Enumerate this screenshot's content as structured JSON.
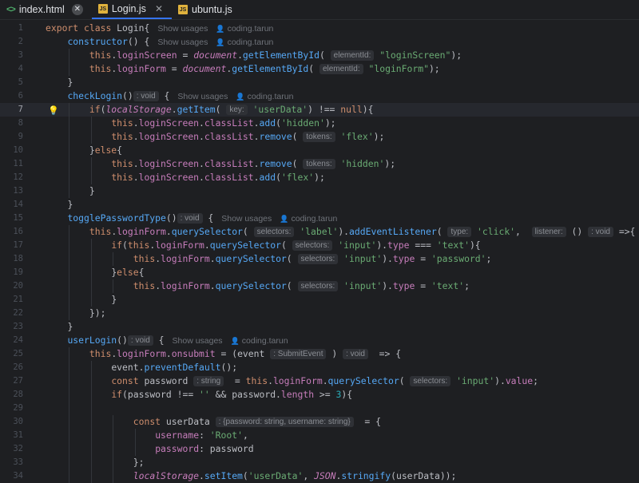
{
  "tabs": [
    {
      "label": "index.html",
      "icon": "html-file-icon",
      "active": false,
      "close": "✕"
    },
    {
      "label": "Login.js",
      "icon": "js-file-icon",
      "active": true,
      "close": "✕"
    },
    {
      "label": "ubuntu.js",
      "icon": "js-file-icon",
      "active": false
    }
  ],
  "editor": {
    "current_line": 7,
    "theme_colors": {
      "keyword": "#cf8e6d",
      "function": "#56a8f5",
      "string": "#6aab73",
      "number": "#2aacb8",
      "global": "#c77dbb"
    },
    "lines": [
      {
        "n": "1",
        "indent": 0,
        "tokens": [
          [
            "kw",
            "export "
          ],
          [
            "kw",
            "class "
          ],
          [
            "pl",
            "Login{"
          ],
          [
            "meta",
            "Show usages"
          ],
          [
            "author",
            "coding.tarun"
          ]
        ]
      },
      {
        "n": "2",
        "indent": 1,
        "tokens": [
          [
            "fn",
            "constructor"
          ],
          [
            "pl",
            "() {"
          ],
          [
            "meta",
            "Show usages"
          ],
          [
            "author",
            "coding.tarun"
          ]
        ]
      },
      {
        "n": "3",
        "indent": 2,
        "tokens": [
          [
            "kw",
            "this"
          ],
          [
            "pl",
            "."
          ],
          [
            "prop",
            "loginScreen"
          ],
          [
            "pl",
            " = "
          ],
          [
            "gv",
            "document"
          ],
          [
            "pl",
            "."
          ],
          [
            "fn",
            "getElementById"
          ],
          [
            "pl",
            "( "
          ],
          [
            "hint",
            "elementId:"
          ],
          [
            "str",
            " \"loginScreen\""
          ],
          [
            "pl",
            ");"
          ]
        ]
      },
      {
        "n": "4",
        "indent": 2,
        "tokens": [
          [
            "kw",
            "this"
          ],
          [
            "pl",
            "."
          ],
          [
            "prop",
            "loginForm"
          ],
          [
            "pl",
            " = "
          ],
          [
            "gv",
            "document"
          ],
          [
            "pl",
            "."
          ],
          [
            "fn",
            "getElementById"
          ],
          [
            "pl",
            "( "
          ],
          [
            "hint",
            "elementId:"
          ],
          [
            "str",
            " \"loginForm\""
          ],
          [
            "pl",
            ");"
          ]
        ]
      },
      {
        "n": "5",
        "indent": 1,
        "tokens": [
          [
            "pl",
            "}"
          ]
        ]
      },
      {
        "n": "6",
        "indent": 1,
        "tokens": [
          [
            "fn",
            "checkLogin"
          ],
          [
            "pl",
            "()"
          ],
          [
            "hint",
            ": void"
          ],
          [
            "pl",
            " {"
          ],
          [
            "meta",
            "Show usages"
          ],
          [
            "author",
            "coding.tarun"
          ]
        ]
      },
      {
        "n": "7",
        "indent": 2,
        "tokens": [
          [
            "kw",
            "if"
          ],
          [
            "pl",
            "("
          ],
          [
            "gv",
            "localStorage"
          ],
          [
            "pl",
            "."
          ],
          [
            "fn",
            "getItem"
          ],
          [
            "pl",
            "( "
          ],
          [
            "hint",
            "key:"
          ],
          [
            "str",
            " 'userData'"
          ],
          [
            "pl",
            ") !== "
          ],
          [
            "kw",
            "null"
          ],
          [
            "pl",
            "){"
          ]
        ]
      },
      {
        "n": "8",
        "indent": 3,
        "tokens": [
          [
            "kw",
            "this"
          ],
          [
            "pl",
            "."
          ],
          [
            "prop",
            "loginScreen"
          ],
          [
            "pl",
            "."
          ],
          [
            "prop",
            "classList"
          ],
          [
            "pl",
            "."
          ],
          [
            "fn",
            "add"
          ],
          [
            "pl",
            "("
          ],
          [
            "str",
            "'hidden'"
          ],
          [
            "pl",
            ");"
          ]
        ]
      },
      {
        "n": "9",
        "indent": 3,
        "tokens": [
          [
            "kw",
            "this"
          ],
          [
            "pl",
            "."
          ],
          [
            "prop",
            "loginScreen"
          ],
          [
            "pl",
            "."
          ],
          [
            "prop",
            "classList"
          ],
          [
            "pl",
            "."
          ],
          [
            "fn",
            "remove"
          ],
          [
            "pl",
            "( "
          ],
          [
            "hint",
            "tokens:"
          ],
          [
            "str",
            " 'flex'"
          ],
          [
            "pl",
            ");"
          ]
        ]
      },
      {
        "n": "10",
        "indent": 2,
        "tokens": [
          [
            "pl",
            "}"
          ],
          [
            "kw",
            "else"
          ],
          [
            "pl",
            "{"
          ]
        ]
      },
      {
        "n": "11",
        "indent": 3,
        "tokens": [
          [
            "kw",
            "this"
          ],
          [
            "pl",
            "."
          ],
          [
            "prop",
            "loginScreen"
          ],
          [
            "pl",
            "."
          ],
          [
            "prop",
            "classList"
          ],
          [
            "pl",
            "."
          ],
          [
            "fn",
            "remove"
          ],
          [
            "pl",
            "( "
          ],
          [
            "hint",
            "tokens:"
          ],
          [
            "str",
            " 'hidden'"
          ],
          [
            "pl",
            ");"
          ]
        ]
      },
      {
        "n": "12",
        "indent": 3,
        "tokens": [
          [
            "kw",
            "this"
          ],
          [
            "pl",
            "."
          ],
          [
            "prop",
            "loginScreen"
          ],
          [
            "pl",
            "."
          ],
          [
            "prop",
            "classList"
          ],
          [
            "pl",
            "."
          ],
          [
            "fn",
            "add"
          ],
          [
            "pl",
            "("
          ],
          [
            "str",
            "'flex'"
          ],
          [
            "pl",
            ");"
          ]
        ]
      },
      {
        "n": "13",
        "indent": 2,
        "tokens": [
          [
            "pl",
            "}"
          ]
        ]
      },
      {
        "n": "14",
        "indent": 1,
        "tokens": [
          [
            "pl",
            "}"
          ]
        ]
      },
      {
        "n": "15",
        "indent": 1,
        "tokens": [
          [
            "fn",
            "togglePasswordType"
          ],
          [
            "pl",
            "()"
          ],
          [
            "hint",
            ": void"
          ],
          [
            "pl",
            " {"
          ],
          [
            "meta",
            "Show usages"
          ],
          [
            "author",
            "coding.tarun"
          ]
        ]
      },
      {
        "n": "16",
        "indent": 2,
        "tokens": [
          [
            "kw",
            "this"
          ],
          [
            "pl",
            "."
          ],
          [
            "prop",
            "loginForm"
          ],
          [
            "pl",
            "."
          ],
          [
            "fn",
            "querySelector"
          ],
          [
            "pl",
            "( "
          ],
          [
            "hint",
            "selectors:"
          ],
          [
            "str",
            " 'label'"
          ],
          [
            "pl",
            ")."
          ],
          [
            "fn",
            "addEventListener"
          ],
          [
            "pl",
            "( "
          ],
          [
            "hint",
            "type:"
          ],
          [
            "str",
            " 'click'"
          ],
          [
            "pl",
            ",  "
          ],
          [
            "hint",
            "listener:"
          ],
          [
            "pl",
            " () "
          ],
          [
            "hint",
            ": void"
          ],
          [
            "pl",
            " =>{"
          ]
        ]
      },
      {
        "n": "17",
        "indent": 3,
        "tokens": [
          [
            "kw",
            "if"
          ],
          [
            "pl",
            "("
          ],
          [
            "kw",
            "this"
          ],
          [
            "pl",
            "."
          ],
          [
            "prop",
            "loginForm"
          ],
          [
            "pl",
            "."
          ],
          [
            "fn",
            "querySelector"
          ],
          [
            "pl",
            "( "
          ],
          [
            "hint",
            "selectors:"
          ],
          [
            "str",
            " 'input'"
          ],
          [
            "pl",
            ")."
          ],
          [
            "prop",
            "type"
          ],
          [
            "pl",
            " === "
          ],
          [
            "str",
            "'text'"
          ],
          [
            "pl",
            "){"
          ]
        ]
      },
      {
        "n": "18",
        "indent": 4,
        "tokens": [
          [
            "kw",
            "this"
          ],
          [
            "pl",
            "."
          ],
          [
            "prop",
            "loginForm"
          ],
          [
            "pl",
            "."
          ],
          [
            "fn",
            "querySelector"
          ],
          [
            "pl",
            "( "
          ],
          [
            "hint",
            "selectors:"
          ],
          [
            "str",
            " 'input'"
          ],
          [
            "pl",
            ")."
          ],
          [
            "prop",
            "type"
          ],
          [
            "pl",
            " = "
          ],
          [
            "str",
            "'password'"
          ],
          [
            "pl",
            ";"
          ]
        ]
      },
      {
        "n": "19",
        "indent": 3,
        "tokens": [
          [
            "pl",
            "}"
          ],
          [
            "kw",
            "else"
          ],
          [
            "pl",
            "{"
          ]
        ]
      },
      {
        "n": "20",
        "indent": 4,
        "tokens": [
          [
            "kw",
            "this"
          ],
          [
            "pl",
            "."
          ],
          [
            "prop",
            "loginForm"
          ],
          [
            "pl",
            "."
          ],
          [
            "fn",
            "querySelector"
          ],
          [
            "pl",
            "( "
          ],
          [
            "hint",
            "selectors:"
          ],
          [
            "str",
            " 'input'"
          ],
          [
            "pl",
            ")."
          ],
          [
            "prop",
            "type"
          ],
          [
            "pl",
            " = "
          ],
          [
            "str",
            "'text'"
          ],
          [
            "pl",
            ";"
          ]
        ]
      },
      {
        "n": "21",
        "indent": 3,
        "tokens": [
          [
            "pl",
            "}"
          ]
        ]
      },
      {
        "n": "22",
        "indent": 2,
        "tokens": [
          [
            "pl",
            "});"
          ]
        ]
      },
      {
        "n": "23",
        "indent": 1,
        "tokens": [
          [
            "pl",
            "}"
          ]
        ]
      },
      {
        "n": "24",
        "indent": 1,
        "tokens": [
          [
            "fn",
            "userLogin"
          ],
          [
            "pl",
            "()"
          ],
          [
            "hint",
            ": void"
          ],
          [
            "pl",
            " {"
          ],
          [
            "meta",
            "Show usages"
          ],
          [
            "author",
            "coding.tarun"
          ]
        ]
      },
      {
        "n": "25",
        "indent": 2,
        "tokens": [
          [
            "kw",
            "this"
          ],
          [
            "pl",
            "."
          ],
          [
            "prop",
            "loginForm"
          ],
          [
            "pl",
            "."
          ],
          [
            "prop",
            "onsubmit"
          ],
          [
            "pl",
            " = (event "
          ],
          [
            "hint",
            ": SubmitEvent"
          ],
          [
            "pl",
            " ) "
          ],
          [
            "hint",
            ": void"
          ],
          [
            "pl",
            "  => {"
          ]
        ]
      },
      {
        "n": "26",
        "indent": 3,
        "tokens": [
          [
            "pl",
            "event."
          ],
          [
            "fn",
            "preventDefault"
          ],
          [
            "pl",
            "();"
          ]
        ]
      },
      {
        "n": "27",
        "indent": 3,
        "tokens": [
          [
            "kw",
            "const "
          ],
          [
            "pl",
            "password "
          ],
          [
            "hint",
            ": string"
          ],
          [
            "pl",
            "  = "
          ],
          [
            "kw",
            "this"
          ],
          [
            "pl",
            "."
          ],
          [
            "prop",
            "loginForm"
          ],
          [
            "pl",
            "."
          ],
          [
            "fn",
            "querySelector"
          ],
          [
            "pl",
            "( "
          ],
          [
            "hint",
            "selectors:"
          ],
          [
            "str",
            " 'input'"
          ],
          [
            "pl",
            ")."
          ],
          [
            "prop",
            "value"
          ],
          [
            "pl",
            ";"
          ]
        ]
      },
      {
        "n": "28",
        "indent": 3,
        "tokens": [
          [
            "kw",
            "if"
          ],
          [
            "pl",
            "(password !== "
          ],
          [
            "str",
            "''"
          ],
          [
            "pl",
            " && password."
          ],
          [
            "prop",
            "length"
          ],
          [
            "pl",
            " >= "
          ],
          [
            "num",
            "3"
          ],
          [
            "pl",
            "){"
          ]
        ]
      },
      {
        "n": "29",
        "indent": 3,
        "tokens": []
      },
      {
        "n": "30",
        "indent": 4,
        "tokens": [
          [
            "kw",
            "const "
          ],
          [
            "pl",
            "userData "
          ],
          [
            "hint",
            ": {password: string, username: string}"
          ],
          [
            "pl",
            "  = {"
          ]
        ]
      },
      {
        "n": "31",
        "indent": 5,
        "tokens": [
          [
            "prop",
            "username"
          ],
          [
            "pl",
            ": "
          ],
          [
            "str",
            "'Root'"
          ],
          [
            "pl",
            ","
          ]
        ]
      },
      {
        "n": "32",
        "indent": 5,
        "tokens": [
          [
            "prop",
            "password"
          ],
          [
            "pl",
            ": password"
          ]
        ]
      },
      {
        "n": "33",
        "indent": 4,
        "tokens": [
          [
            "pl",
            "};"
          ]
        ]
      },
      {
        "n": "34",
        "indent": 4,
        "tokens": [
          [
            "gv",
            "localStorage"
          ],
          [
            "pl",
            "."
          ],
          [
            "fn",
            "setItem"
          ],
          [
            "pl",
            "("
          ],
          [
            "str",
            "'userData'"
          ],
          [
            "pl",
            ", "
          ],
          [
            "gv",
            "JSON"
          ],
          [
            "pl",
            "."
          ],
          [
            "fn",
            "stringify"
          ],
          [
            "pl",
            "(userData));"
          ]
        ]
      }
    ]
  }
}
